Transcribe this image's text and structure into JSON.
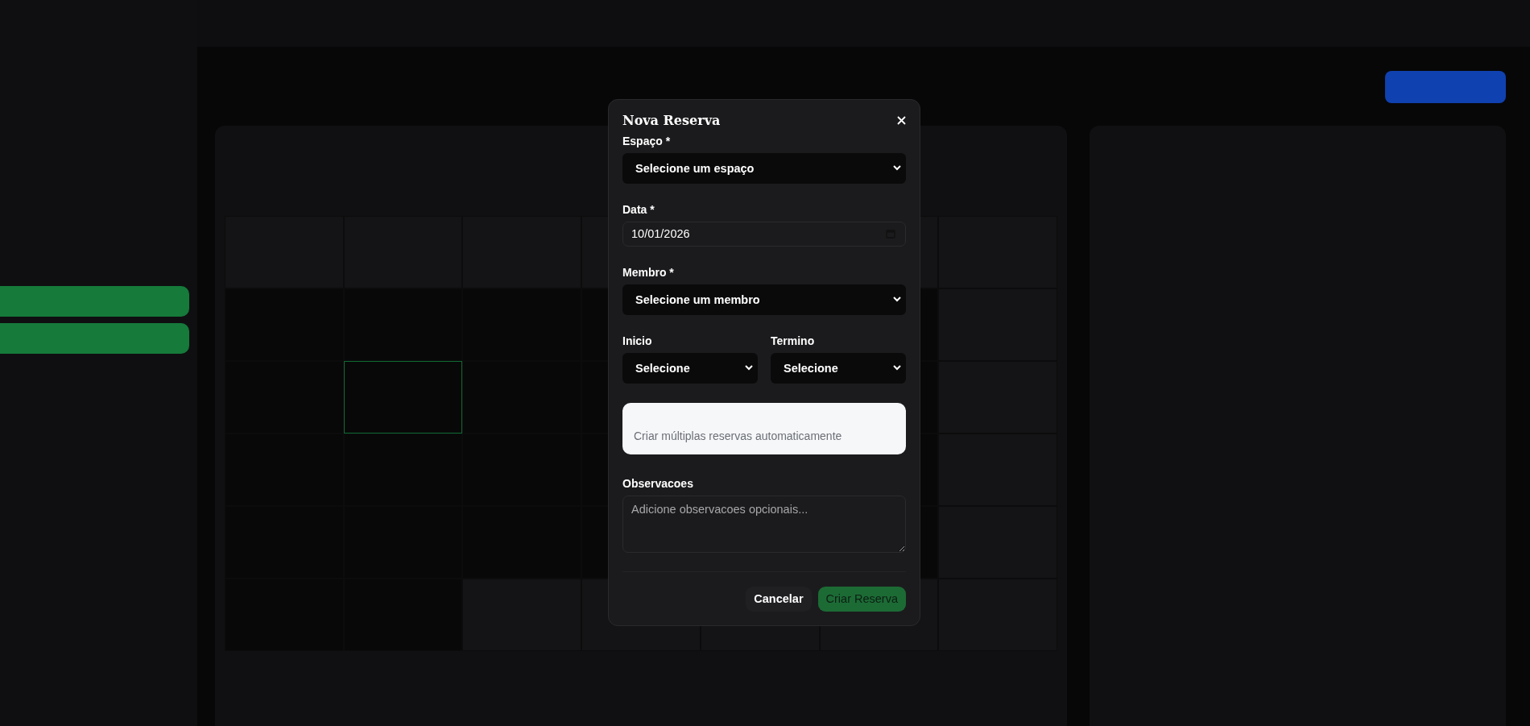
{
  "dialog": {
    "title": "Nova Reserva",
    "fields": [
      {
        "kind": "select",
        "label": "Espaço *",
        "value": "Selecione um espaço"
      },
      {
        "kind": "date",
        "label": "Data *",
        "value": "10/01/2026"
      },
      {
        "kind": "select",
        "label": "Membro *",
        "value": "Selecione um membro"
      },
      {
        "kind": "pair",
        "items": [
          {
            "label": "Inicio",
            "value": "Selecione"
          },
          {
            "label": "Termino",
            "value": "Selecione"
          }
        ]
      },
      {
        "kind": "note",
        "text": "Criar múltiplas reservas automaticamente"
      },
      {
        "kind": "textarea",
        "label": "Observacoes",
        "placeholder": "Adicione observacoes opcionais..."
      }
    ],
    "buttons": [
      {
        "kind": "secondary",
        "label": "Cancelar"
      },
      {
        "kind": "primary",
        "label": "Criar Reserva"
      }
    ]
  }
}
